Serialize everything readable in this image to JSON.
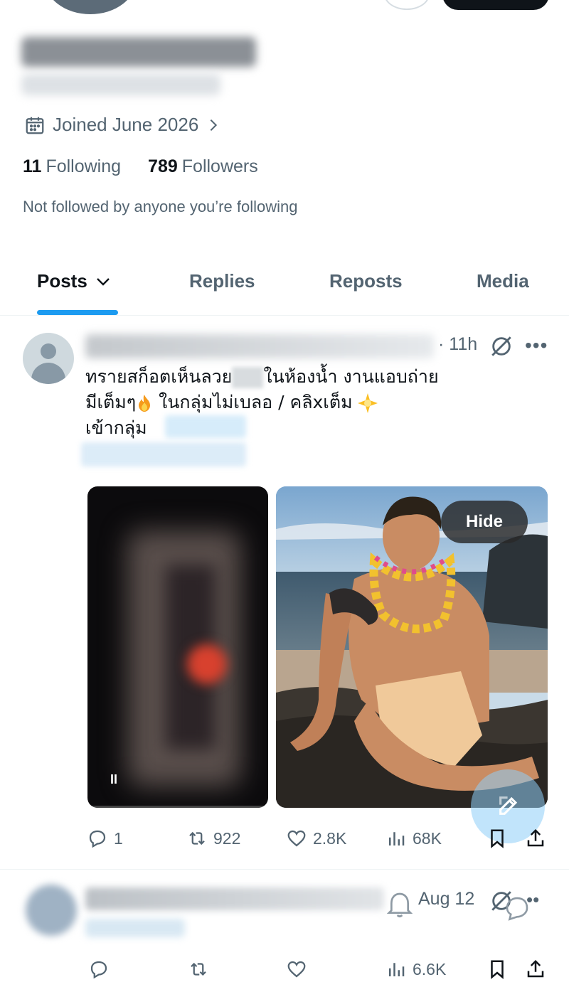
{
  "profile": {
    "name": "",
    "handle": "",
    "joined": "Joined June 2026",
    "following_count": "11",
    "following_label": "Following",
    "followers_count": "789",
    "followers_label": "Followers",
    "not_followed_text": "Not followed by anyone you’re following"
  },
  "tabs": [
    {
      "label": "Posts"
    },
    {
      "label": "Replies"
    },
    {
      "label": "Reposts"
    },
    {
      "label": "Media"
    }
  ],
  "post1": {
    "time": "· 11h",
    "text_line1_a": "ทรายสก็อตเห็นลวย",
    "text_line1_b": "ในห้องน้ำ งานแอบถ่าย",
    "text_line2_a": "มีเต็มๆ",
    "text_line2_b": " ในกลุ่มไม่เบลอ / คลิxเต็ม",
    "text_line3": " เข้ากลุ่ม",
    "hide_label": "Hide",
    "pause_icon": "II",
    "replies": "1",
    "reposts": "922",
    "likes": "2.8K",
    "views": "68K"
  },
  "post2": {
    "time": "Aug 12",
    "views": "6.6K"
  },
  "colors": {
    "accent": "#1d9bf0",
    "text_primary": "#0f1419",
    "text_secondary": "#536471"
  }
}
